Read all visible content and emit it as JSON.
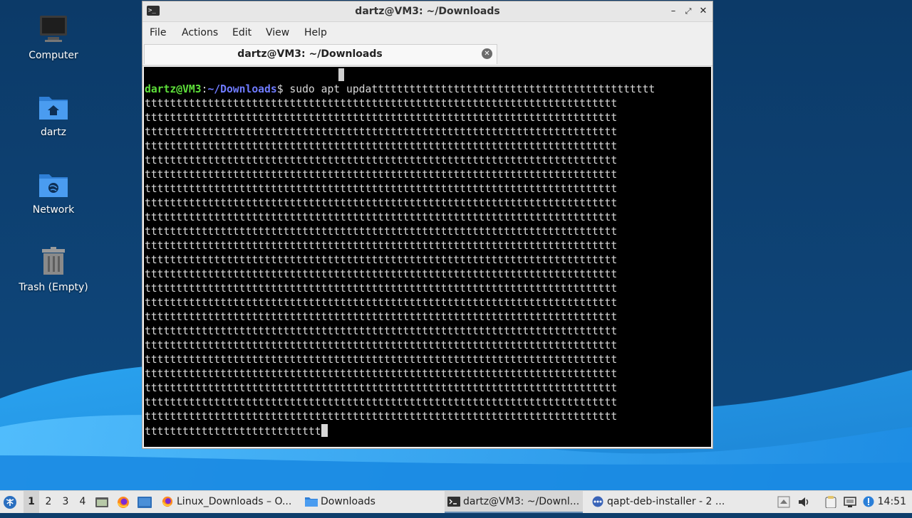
{
  "desktop": {
    "icons": [
      {
        "label": "Computer"
      },
      {
        "label": "dartz"
      },
      {
        "label": "Network"
      },
      {
        "label": "Trash (Empty)"
      }
    ]
  },
  "window": {
    "title": "dartz@VM3: ~/Downloads",
    "title_icon": "terminal-icon",
    "controls": [
      "minimize",
      "maximize",
      "close"
    ],
    "menu": [
      "File",
      "Actions",
      "Edit",
      "View",
      "Help"
    ],
    "tab": {
      "title": "dartz@VM3: ~/Downloads"
    }
  },
  "terminal": {
    "prompt_user": "dartz@VM3",
    "prompt_sep": ":",
    "prompt_path": "~/Downloads",
    "prompt_sym": "$ ",
    "first_line_cmd": "sudo apt updattttttttttttttttttttttttttttttttttttttttttttt",
    "full_line": "ttttttttttttttttttttttttttttttttttttttttttttttttttttttttttttttttttttttttttt",
    "full_line_count": 23,
    "last_line": "tttttttttttttttttttttttttttt"
  },
  "taskbar": {
    "start_icon": "xubuntu-logo-icon",
    "workspaces": [
      "1",
      "2",
      "3",
      "4"
    ],
    "active_workspace": "1",
    "launchers": [
      "file-manager-icon",
      "firefox-icon",
      "desktop-icon"
    ],
    "tasks": [
      {
        "label": "Linux_Downloads – O...",
        "icon": "firefox-icon"
      },
      {
        "label": "Downloads",
        "icon": "folder-icon"
      },
      {
        "label": "dartz@VM3: ~/Downl...",
        "icon": "terminal-icon"
      },
      {
        "label": "qapt-deb-installer - 2 ...",
        "icon": "dots-icon"
      }
    ],
    "tray": [
      "up-arrow-icon",
      "volume-icon",
      "clipboard-icon",
      "network-icon",
      "update-icon"
    ],
    "clock": "14:51"
  },
  "colors": {
    "wallpaper_dark": "#0d3d6b",
    "wallpaper_light": "#1b8fe0",
    "prompt_user": "#5ee03a",
    "prompt_path": "#6f7bff"
  }
}
